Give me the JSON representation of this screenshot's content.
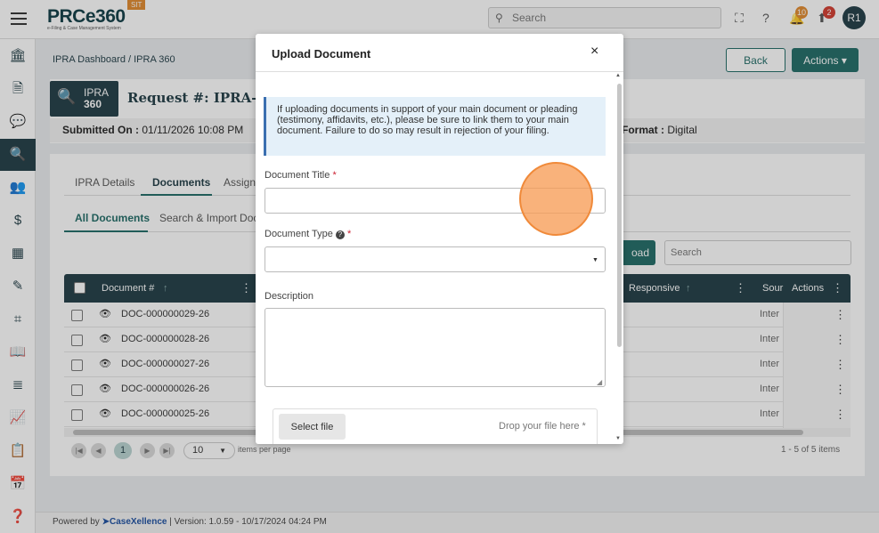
{
  "app": {
    "logo": "PRCe360",
    "env_tag": "SIT",
    "logo_subtitle": "e-Filing & Case Management System"
  },
  "topbar": {
    "search_placeholder": "Search",
    "notifications_count": "10",
    "uploads_count": "2",
    "avatar_initials": "R1",
    "colors": {
      "notif_badge": "#e08a2e",
      "upload_badge": "#d23b2f"
    }
  },
  "sidebar": {
    "items": [
      {
        "icon": "bank-icon"
      },
      {
        "icon": "document-icon"
      },
      {
        "icon": "chat-icon"
      },
      {
        "icon": "document-search-icon",
        "active": true
      },
      {
        "icon": "users-icon"
      },
      {
        "icon": "dollar-document-icon"
      },
      {
        "icon": "building-icon"
      },
      {
        "icon": "note-icon"
      },
      {
        "icon": "scan-icon"
      },
      {
        "icon": "book-icon"
      },
      {
        "icon": "file-text-icon"
      },
      {
        "icon": "chart-icon"
      },
      {
        "icon": "clipboard-icon"
      },
      {
        "icon": "calendar-icon"
      },
      {
        "icon": "help-document-icon"
      }
    ]
  },
  "breadcrumb": "IPRA Dashboard / IPRA 360",
  "buttons": {
    "back": "Back",
    "actions": "Actions ▾"
  },
  "request": {
    "badge_line1": "IPRA",
    "badge_line2": "360",
    "title": "Request #: IPRA-CNE",
    "submitted_label": "Submitted On :",
    "submitted_value": "01/11/2026 10:08 PM",
    "submitted_trail": "Su",
    "format_label": "Format :",
    "format_value": "Digital"
  },
  "tabs": [
    "IPRA Details",
    "Documents",
    "Assign"
  ],
  "subtabs": [
    "All Documents",
    "Search & Import Doc"
  ],
  "grid": {
    "upload_label": "oad",
    "search_placeholder": "Search",
    "columns": {
      "doc_num": "Document #",
      "responsive": "Responsive",
      "source": "Sour",
      "actions": "Actions"
    },
    "rows": [
      {
        "doc": "DOC-000000029-26",
        "source": "Inter"
      },
      {
        "doc": "DOC-000000028-26",
        "source": "Inter"
      },
      {
        "doc": "DOC-000000027-26",
        "source": "Inter"
      },
      {
        "doc": "DOC-000000026-26",
        "source": "Inter"
      },
      {
        "doc": "DOC-000000025-26",
        "source": "Inter"
      }
    ]
  },
  "pager": {
    "page": "1",
    "page_size": "10",
    "items_per_page": "items per page",
    "count": "1 - 5 of 5 items"
  },
  "footer": {
    "powered_by": "Powered by",
    "brand": "CaseXellence",
    "version": "|  Version: 1.0.59 - 10/17/2024 04:24 PM"
  },
  "modal": {
    "title": "Upload Document",
    "close": "×",
    "info": "If uploading documents in support of your main document or pleading (testimony, affidavits, etc.), please be sure to link them to your main document. Failure to do so may result in rejection of your filing.",
    "doc_title_label": "Document Title",
    "doc_title_value": "",
    "doc_type_label": "Document Type",
    "doc_type_value": "",
    "description_label": "Description",
    "description_value": "",
    "required_mark": "*",
    "select_file": "Select file",
    "drop_text": "Drop your file here *"
  }
}
